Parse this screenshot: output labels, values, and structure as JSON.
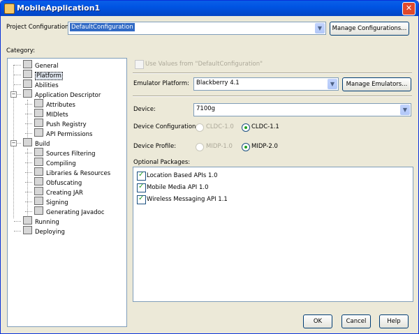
{
  "window": {
    "title": "MobileApplication1",
    "close_glyph": "✕"
  },
  "project": {
    "label": "Project Configuration:",
    "selected": "DefaultConfiguration",
    "manage_button": "Manage Configurations..."
  },
  "category_label": "Category:",
  "tree": [
    {
      "label": "General",
      "icon": "general-icon"
    },
    {
      "label": "Platform",
      "icon": "platform-icon",
      "selected": true
    },
    {
      "label": "Abilities",
      "icon": "abilities-icon"
    },
    {
      "label": "Application Descriptor",
      "icon": "descriptor-icon",
      "expand": "−"
    },
    {
      "label": "Attributes",
      "icon": "attributes-icon"
    },
    {
      "label": "MIDlets",
      "icon": "midlets-icon"
    },
    {
      "label": "Push Registry",
      "icon": "push-registry-icon"
    },
    {
      "label": "API Permissions",
      "icon": "api-permissions-icon"
    },
    {
      "label": "Build",
      "icon": "build-icon",
      "expand": "−"
    },
    {
      "label": "Sources Filtering",
      "icon": "sources-filtering-icon"
    },
    {
      "label": "Compiling",
      "icon": "compiling-icon"
    },
    {
      "label": "Libraries & Resources",
      "icon": "libraries-icon"
    },
    {
      "label": "Obfuscating",
      "icon": "obfuscating-icon"
    },
    {
      "label": "Creating JAR",
      "icon": "creating-jar-icon"
    },
    {
      "label": "Signing",
      "icon": "signing-icon"
    },
    {
      "label": "Generating Javadoc",
      "icon": "javadoc-icon"
    },
    {
      "label": "Running",
      "icon": "running-icon"
    },
    {
      "label": "Deploying",
      "icon": "deploying-icon"
    }
  ],
  "panel": {
    "use_values_label": "Use Values from \"DefaultConfiguration\"",
    "emulator_label": "Emulator Platform:",
    "emulator_value": "Blackberry 4.1",
    "manage_emulators": "Manage Emulators...",
    "device_label": "Device:",
    "device_value": "7100g",
    "device_config_label": "Device Configuration:",
    "cldc10": "CLDC-1.0",
    "cldc11": "CLDC-1.1",
    "device_profile_label": "Device Profile:",
    "midp10": "MIDP-1.0",
    "midp20": "MIDP-2.0",
    "optional_label": "Optional Packages:",
    "packages": [
      {
        "label": "Location Based APIs 1.0",
        "checked": true
      },
      {
        "label": "Mobile Media API 1.0",
        "checked": true
      },
      {
        "label": "Wireless Messaging API 1.1",
        "checked": true
      }
    ]
  },
  "buttons": {
    "ok": "OK",
    "cancel": "Cancel",
    "help": "Help"
  },
  "colors": {
    "title_blue": "#0054e3",
    "selection": "#316ac5",
    "check_green": "#21a121"
  }
}
